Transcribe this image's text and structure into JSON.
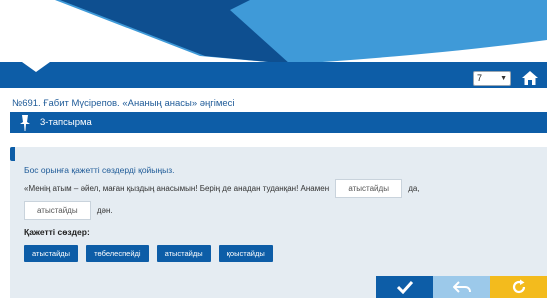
{
  "header": {
    "page_select": {
      "value": "7"
    },
    "icons": {
      "home": "home-icon",
      "caret": "chevron-down-icon"
    }
  },
  "lesson": {
    "title": "№691. Ғабит Мүсірепов. «Ананың анасы» әңгімесі"
  },
  "task": {
    "label": "3-тапсырма",
    "icon": "pen-icon"
  },
  "exercise": {
    "instruction": "Бос орынға қажетті сөздерді қойыңыз.",
    "sentence_part1": "«Менің атым – әйел, маған қыздың анасымын! Берің де анадан туданқан! Анамен",
    "blank1": "атыстайды",
    "sentence_part2": "да,",
    "blank2": "атыстайды",
    "sentence_part3": "дән.",
    "words_heading": "Қажетті сөздер:",
    "words": [
      "атыстайды",
      "төбелеспейді",
      "атыстайды",
      "қоыстайды"
    ]
  },
  "actions": {
    "check": "check-icon",
    "undo": "undo-icon",
    "restart": "restart-icon"
  },
  "colors": {
    "brand_blue": "#0d5da7",
    "light_blue": "#9cc9ea",
    "accent_yellow": "#f3bb1d",
    "panel_bg": "#e5ecf2"
  }
}
